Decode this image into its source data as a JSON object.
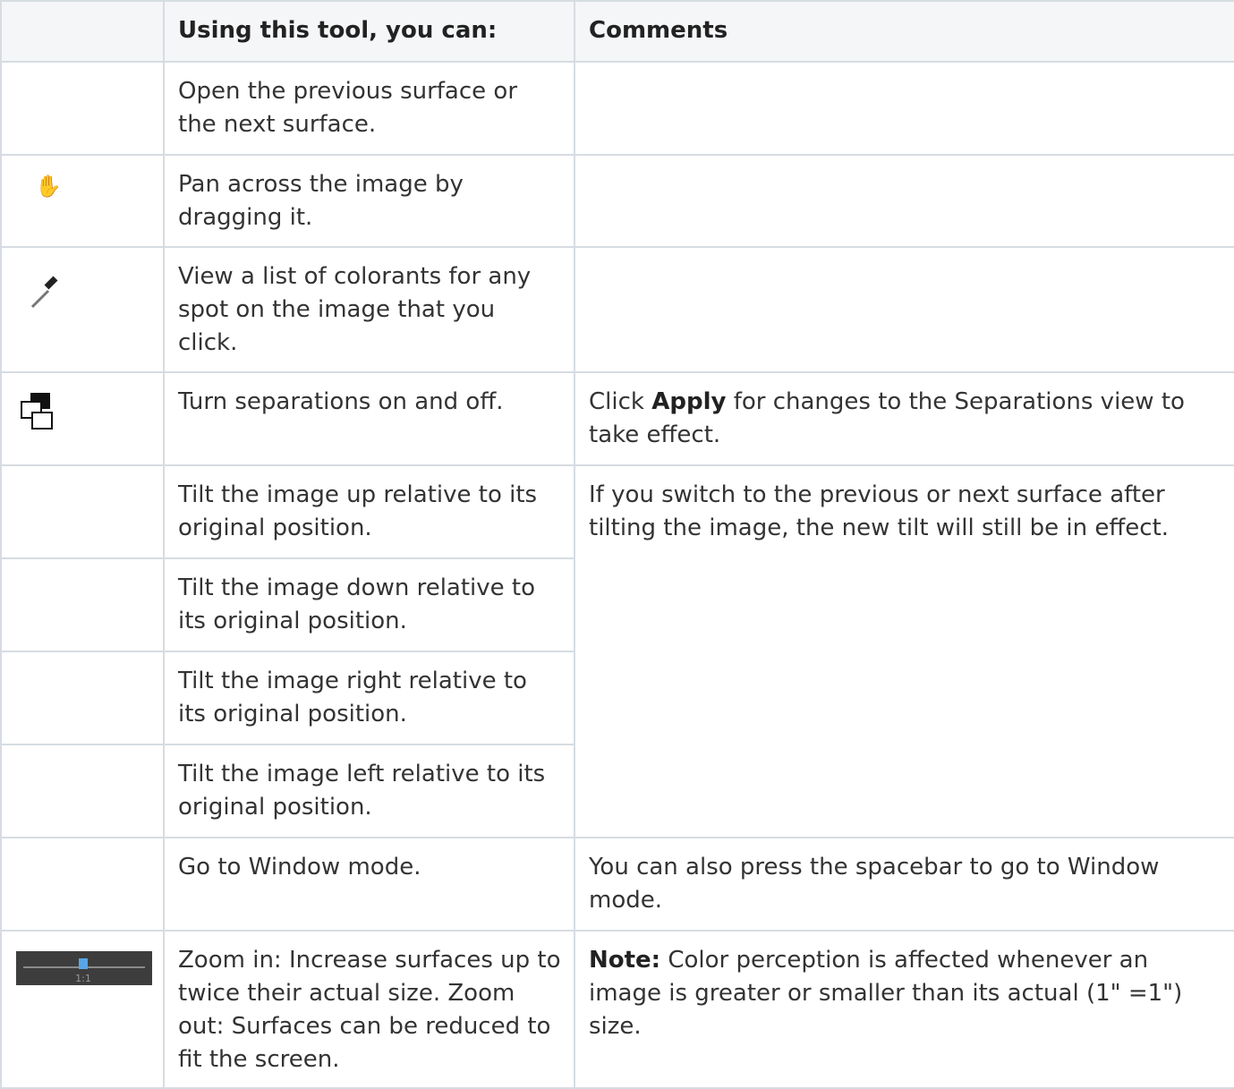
{
  "header": {
    "col_icon": "",
    "col_action": "Using this tool, you can:",
    "col_comments": "Comments"
  },
  "rows": [
    {
      "icon": "",
      "action": "Open the previous surface or the next surface.",
      "comment": ""
    },
    {
      "icon": "hand-icon",
      "action": "Pan across the image by dragging it.",
      "comment": ""
    },
    {
      "icon": "eyedropper-icon",
      "action": "View a list of colorants for any spot on the image that you click.",
      "comment": ""
    },
    {
      "icon": "separations-icon",
      "action": "Turn separations on and off.",
      "comment_pre": "Click ",
      "comment_bold": "Apply",
      "comment_post": " for changes to the Separations view to take effect."
    },
    {
      "icon": "",
      "action": "Tilt the image up relative to its original position.",
      "comment": "If you switch to the previous or next surface after tilting the image, the new tilt will still be in effect."
    },
    {
      "icon": "",
      "action": "Tilt the image down relative to its original position."
    },
    {
      "icon": "",
      "action": "Tilt the image right relative to its original position."
    },
    {
      "icon": "",
      "action": "Tilt the image left relative to its original position."
    },
    {
      "icon": "",
      "action": "Go to Window mode.",
      "comment": "You can also press the spacebar to go to Window mode."
    },
    {
      "icon": "zoom-slider-icon",
      "zoom_label": "1:1",
      "action": "Zoom in: Increase surfaces up to twice their actual size. Zoom out: Surfaces can be reduced to fit the screen.",
      "comment_bold": "Note:",
      "comment_post": " Color perception is affected whenever an image is greater or smaller than its actual (1\" =1\") size."
    }
  ]
}
